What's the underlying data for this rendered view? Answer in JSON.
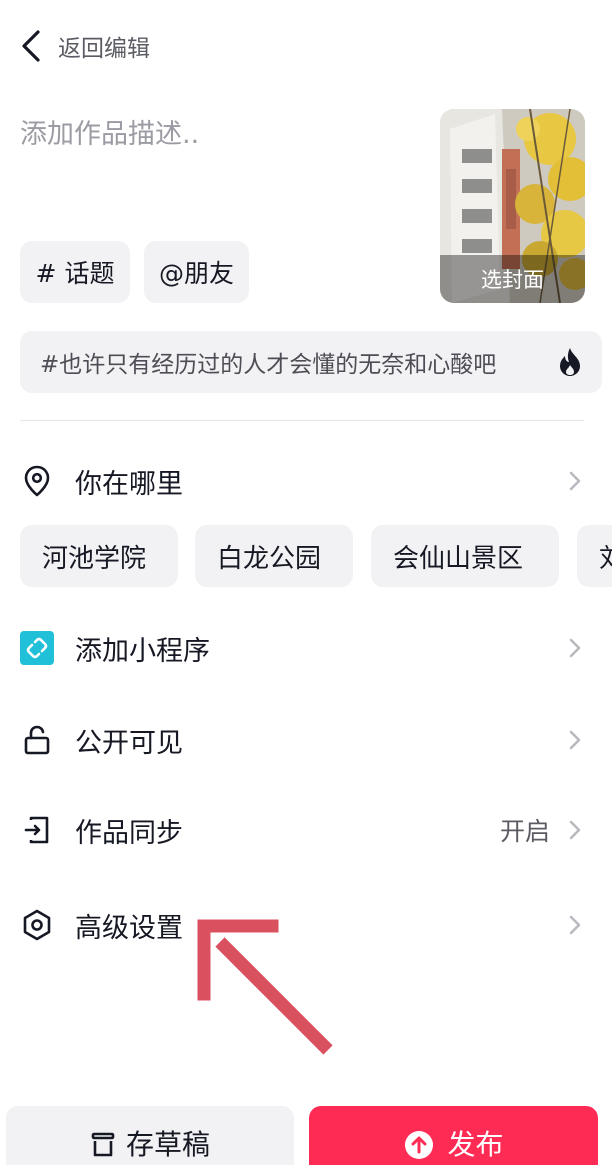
{
  "header": {
    "back_label": "返回编辑"
  },
  "description": {
    "placeholder": "添加作品描述.."
  },
  "cover": {
    "label": "选封面"
  },
  "tag_chips": {
    "topic": "# 话题",
    "friend": "@朋友"
  },
  "hot_topic": {
    "text": "#也许只有经历过的人才会懂的无奈和心酸吧",
    "icon": "fire-icon"
  },
  "location": {
    "label": "你在哪里",
    "suggestions": [
      "河池学院",
      "白龙公园",
      "会仙山景区",
      "刘"
    ]
  },
  "mini_program": {
    "label": "添加小程序"
  },
  "visibility": {
    "label": "公开可见"
  },
  "sync": {
    "label": "作品同步",
    "value": "开启"
  },
  "advanced": {
    "label": "高级设置"
  },
  "bottom": {
    "draft_label": "存草稿",
    "publish_label": "发布"
  },
  "colors": {
    "accent": "#fe2c55",
    "mini_program_icon": "#20c0d8",
    "annotation_arrow": "#d9505e"
  }
}
